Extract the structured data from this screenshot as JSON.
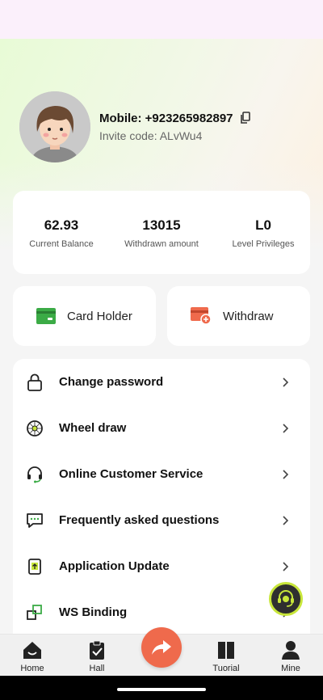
{
  "profile": {
    "mobile_label": "Mobile: +923265982897",
    "invite_label": "Invite code: ALvWu4"
  },
  "stats": [
    {
      "value": "62.93",
      "label": "Current Balance"
    },
    {
      "value": "13015",
      "label": "Withdrawn amount"
    },
    {
      "value": "L0",
      "label": "Level Privileges"
    }
  ],
  "actions": {
    "card_holder": "Card Holder",
    "withdraw": "Withdraw"
  },
  "menu": [
    {
      "label": "Change password",
      "icon": "lock-icon"
    },
    {
      "label": "Wheel draw",
      "icon": "wheel-icon"
    },
    {
      "label": "Online Customer Service",
      "icon": "headset-icon"
    },
    {
      "label": "Frequently asked questions",
      "icon": "chat-icon"
    },
    {
      "label": "Application Update",
      "icon": "update-icon"
    },
    {
      "label": "WS Binding",
      "icon": "link-icon"
    }
  ],
  "nav": [
    {
      "label": "Home",
      "icon": "home-icon"
    },
    {
      "label": "Hall",
      "icon": "clipboard-icon"
    },
    {
      "label": "Tuorial",
      "icon": "book-icon"
    },
    {
      "label": "Mine",
      "icon": "user-icon"
    }
  ],
  "colors": {
    "accent_green": "#3bab46",
    "accent_orange": "#ef6a4c",
    "support_ring": "#c8e63a"
  }
}
